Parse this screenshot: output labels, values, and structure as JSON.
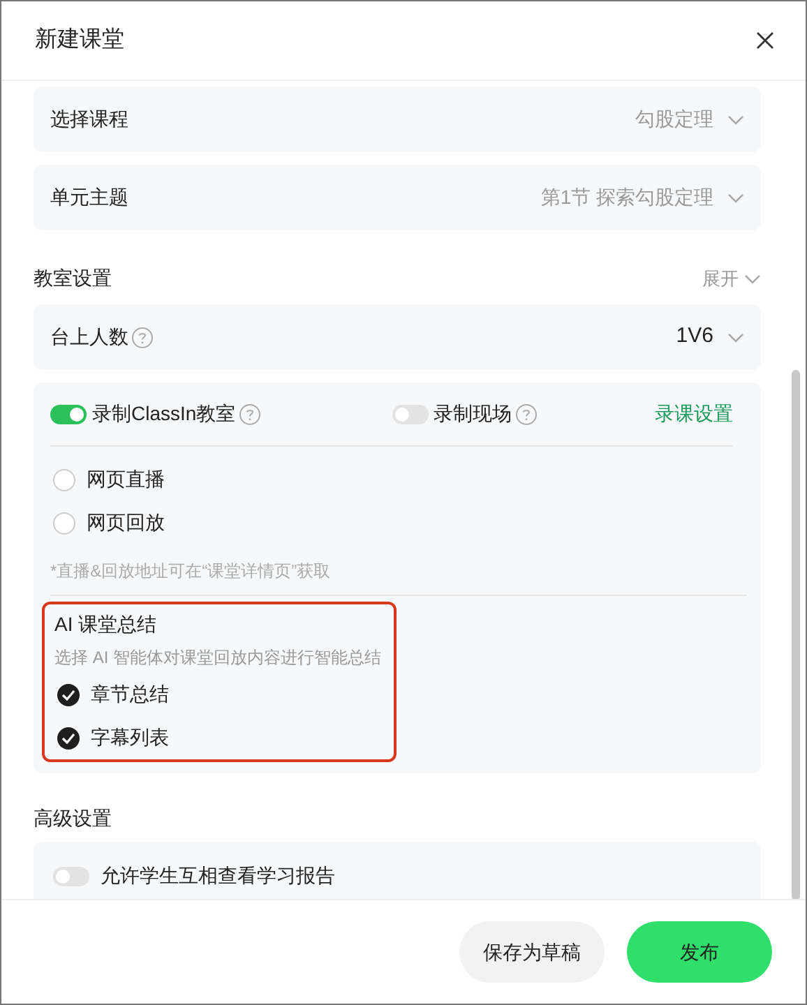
{
  "dialog": {
    "title": "新建课堂"
  },
  "selects": [
    {
      "label": "选择课程",
      "value": "勾股定理"
    },
    {
      "label": "单元主题",
      "value": "第1节 探索勾股定理"
    }
  ],
  "classroom_settings": {
    "title": "教室设置",
    "expand_label": "展开",
    "stage_count": {
      "label": "台上人数",
      "value": "1V6"
    },
    "recording": {
      "toggles": [
        {
          "label": "录制ClassIn教室",
          "on": true
        },
        {
          "label": "录制现场",
          "on": false
        }
      ],
      "settings_link": "录课设置",
      "web_options": [
        {
          "label": "网页直播",
          "checked": false
        },
        {
          "label": "网页回放",
          "checked": false
        }
      ],
      "note": "*直播&回放地址可在“课堂详情页”获取",
      "ai_summary": {
        "title": "AI 课堂总结",
        "description": "选择 AI 智能体对课堂回放内容进行智能总结",
        "highlighted": true,
        "options": [
          {
            "label": "章节总结",
            "checked": true
          },
          {
            "label": "字幕列表",
            "checked": true
          }
        ]
      }
    }
  },
  "advanced_settings": {
    "title": "高级设置",
    "toggles": [
      {
        "label": "允许学生互相查看学习报告",
        "on": false
      }
    ]
  },
  "buttons": [
    {
      "label": "保存为草稿",
      "kind": "secondary"
    },
    {
      "label": "发布",
      "kind": "primary"
    }
  ]
}
